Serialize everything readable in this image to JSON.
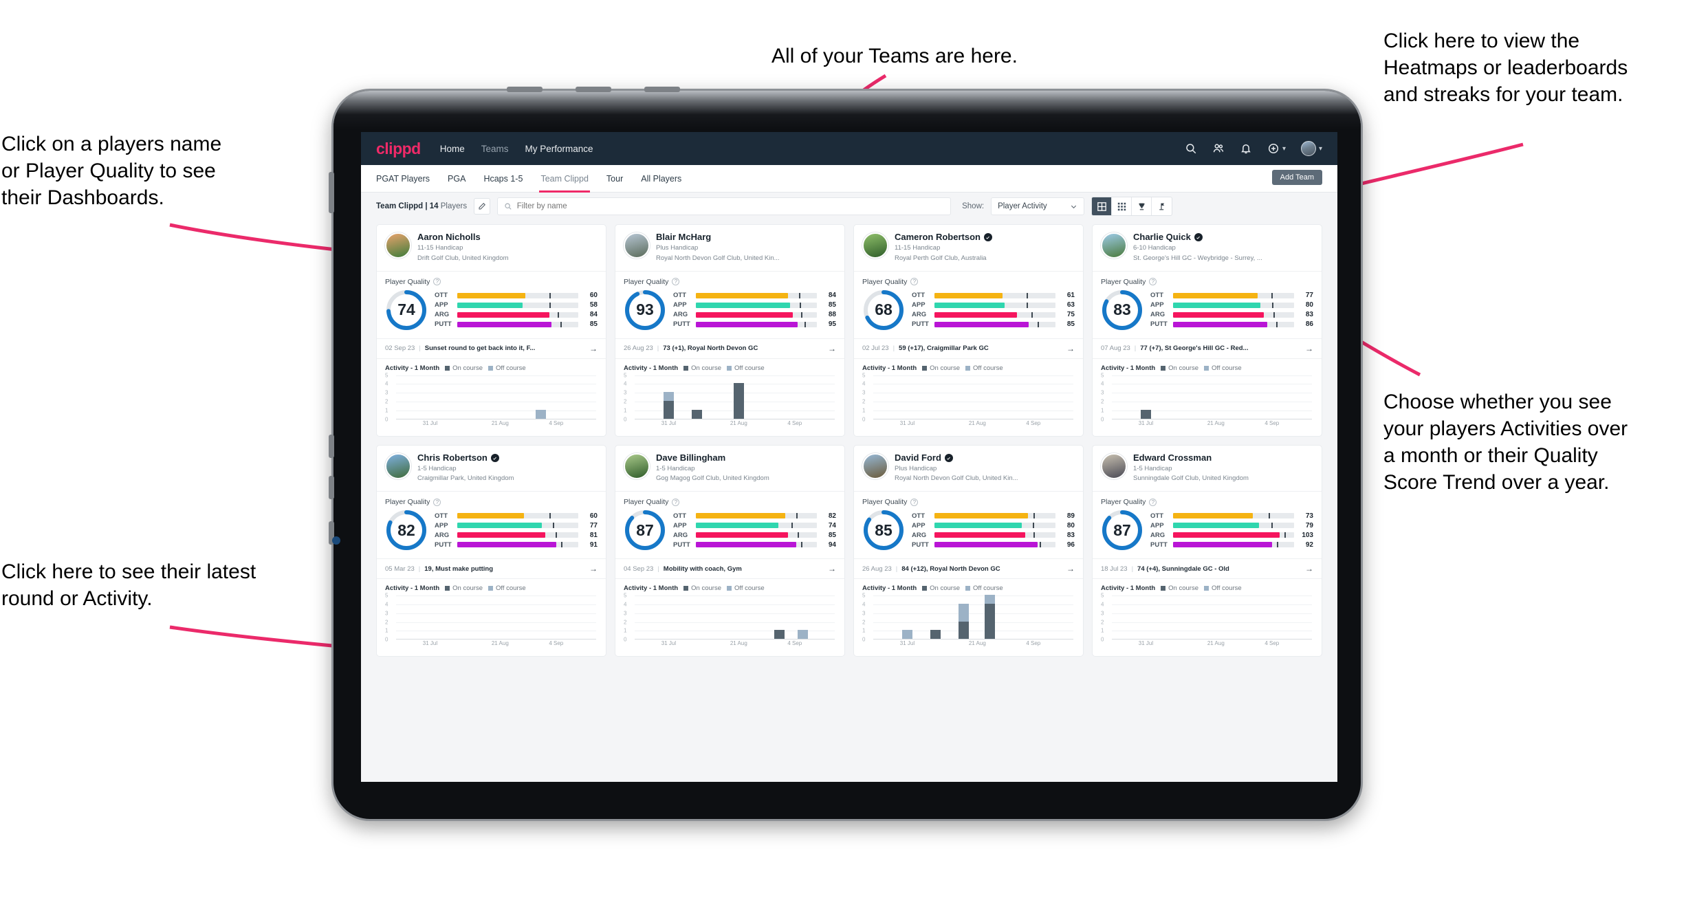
{
  "annotations": {
    "top_left": "Click on a players name\nor Player Quality to see\ntheir Dashboards.",
    "top_center": "All of your Teams are here.",
    "top_right": "Click here to view the\nHeatmaps or leaderboards\nand streaks for your team.",
    "right_middle": "Choose whether you see\nyour players Activities over\na month or their Quality\nScore Trend over a year.",
    "bottom_left": "Click here to see their latest\nround or Activity."
  },
  "navbar": {
    "logo": "clippd",
    "links": [
      {
        "label": "Home",
        "dim": false
      },
      {
        "label": "Teams",
        "dim": true
      },
      {
        "label": "My Performance",
        "dim": false
      }
    ],
    "icons": [
      "search-icon",
      "people-icon",
      "bell-icon",
      "plus-circle-icon",
      "avatar"
    ]
  },
  "tabs": [
    {
      "label": "PGAT Players",
      "active": false
    },
    {
      "label": "PGA",
      "active": false
    },
    {
      "label": "Hcaps 1-5",
      "active": false
    },
    {
      "label": "Team Clippd",
      "active": true
    },
    {
      "label": "Tour",
      "active": false
    },
    {
      "label": "All Players",
      "active": false
    }
  ],
  "add_team_label": "Add Team",
  "toolbar": {
    "team_name": "Team Clippd | 14",
    "team_suffix": " Players",
    "edit_icon": "pencil-icon",
    "search_placeholder": "Filter by name",
    "search_value": "",
    "show_label": "Show:",
    "show_value": "Player Activity",
    "views": [
      {
        "name": "grid-view-icon",
        "active": true
      },
      {
        "name": "dense-grid-view-icon",
        "active": false
      },
      {
        "name": "trophy-view-icon",
        "active": false
      },
      {
        "name": "flag-view-icon",
        "active": false
      }
    ]
  },
  "card_labels": {
    "player_quality": "Player Quality",
    "activity_title": "Activity - 1 Month",
    "legend_on": "On course",
    "legend_off": "Off course"
  },
  "metric_colors": {
    "OTT": "#f5b312",
    "APP": "#2fd6ae",
    "ARG": "#f5155e",
    "PUTT": "#b915d6",
    "ring": "#1678c8",
    "ring_track": "#dfe3e7",
    "on_course": "#55646f",
    "off_course": "#9cb2c6",
    "brand": "#ef2a68",
    "annotation_arrow": "#eb2a6a"
  },
  "chart_data": {
    "type": "bar",
    "title": "Activity - 1 Month",
    "stacked": true,
    "ylim": [
      0,
      5
    ],
    "yticks": [
      0,
      1,
      2,
      3,
      4,
      5
    ],
    "xlabel": "",
    "ylabel": "",
    "xticks": [
      "31 Jul",
      "21 Aug",
      "4 Sep"
    ],
    "legend": [
      "On course",
      "Off course"
    ],
    "legend_position": "top",
    "grid": true
  },
  "players": [
    {
      "name": "Aaron Nicholls",
      "verified": false,
      "handicap": "11-15 Handicap",
      "club": "Drift Golf Club, United Kingdom",
      "quality": 74,
      "metrics": [
        {
          "key": "OTT",
          "value": 60,
          "fill": 56,
          "tick": 76
        },
        {
          "key": "APP",
          "value": 58,
          "fill": 54,
          "tick": 76
        },
        {
          "key": "ARG",
          "value": 84,
          "fill": 76,
          "tick": 83
        },
        {
          "key": "PUTT",
          "value": 85,
          "fill": 78,
          "tick": 85
        }
      ],
      "last_date": "02 Sep 23",
      "last_text": "Sunset round to get back into it, F...",
      "avatar_from": "#e8a36d",
      "avatar_to": "#3e7c3a",
      "activity": [
        {
          "x": 0.72,
          "on": 0,
          "off": 1
        }
      ]
    },
    {
      "name": "Blair McHarg",
      "verified": false,
      "handicap": "Plus Handicap",
      "club": "Royal North Devon Golf Club, United Kin...",
      "quality": 93,
      "metrics": [
        {
          "key": "OTT",
          "value": 84,
          "fill": 76,
          "tick": 85
        },
        {
          "key": "APP",
          "value": 85,
          "fill": 78,
          "tick": 86
        },
        {
          "key": "ARG",
          "value": 88,
          "fill": 80,
          "tick": 87
        },
        {
          "key": "PUTT",
          "value": 95,
          "fill": 84,
          "tick": 90
        }
      ],
      "last_date": "26 Aug 23",
      "last_text": "73 (+1), Royal North Devon GC",
      "avatar_from": "#b7c6d4",
      "avatar_to": "#5a6b5a",
      "activity": [
        {
          "x": 0.17,
          "on": 2,
          "off": 1
        },
        {
          "x": 0.31,
          "on": 1,
          "off": 0
        },
        {
          "x": 0.52,
          "on": 4,
          "off": 0
        }
      ]
    },
    {
      "name": "Cameron Robertson",
      "verified": true,
      "handicap": "11-15 Handicap",
      "club": "Royal Perth Golf Club, Australia",
      "quality": 68,
      "metrics": [
        {
          "key": "OTT",
          "value": 61,
          "fill": 56,
          "tick": 76
        },
        {
          "key": "APP",
          "value": 63,
          "fill": 58,
          "tick": 76
        },
        {
          "key": "ARG",
          "value": 75,
          "fill": 68,
          "tick": 80
        },
        {
          "key": "PUTT",
          "value": 85,
          "fill": 78,
          "tick": 85
        }
      ],
      "last_date": "02 Jul 23",
      "last_text": "59 (+17), Craigmillar Park GC",
      "avatar_from": "#8fbf6a",
      "avatar_to": "#2f5e2a",
      "activity": []
    },
    {
      "name": "Charlie Quick",
      "verified": true,
      "handicap": "6-10 Handicap",
      "club": "St. George's Hill GC - Weybridge - Surrey, ...",
      "quality": 83,
      "metrics": [
        {
          "key": "OTT",
          "value": 77,
          "fill": 70,
          "tick": 81
        },
        {
          "key": "APP",
          "value": 80,
          "fill": 72,
          "tick": 82
        },
        {
          "key": "ARG",
          "value": 83,
          "fill": 75,
          "tick": 83
        },
        {
          "key": "PUTT",
          "value": 86,
          "fill": 78,
          "tick": 85
        }
      ],
      "last_date": "07 Aug 23",
      "last_text": "77 (+7), St George's Hill GC - Red...",
      "avatar_from": "#9ecbe8",
      "avatar_to": "#4a7a3c",
      "activity": [
        {
          "x": 0.17,
          "on": 1,
          "off": 0
        }
      ]
    },
    {
      "name": "Chris Robertson",
      "verified": true,
      "handicap": "1-5 Handicap",
      "club": "Craigmillar Park, United Kingdom",
      "quality": 82,
      "metrics": [
        {
          "key": "OTT",
          "value": 60,
          "fill": 55,
          "tick": 76
        },
        {
          "key": "APP",
          "value": 77,
          "fill": 70,
          "tick": 79
        },
        {
          "key": "ARG",
          "value": 81,
          "fill": 73,
          "tick": 81
        },
        {
          "key": "PUTT",
          "value": 91,
          "fill": 82,
          "tick": 86
        }
      ],
      "last_date": "05 Mar 23",
      "last_text": "19, Must make putting",
      "avatar_from": "#7fb0e0",
      "avatar_to": "#3f6b3a",
      "activity": []
    },
    {
      "name": "Dave Billingham",
      "verified": false,
      "handicap": "1-5 Handicap",
      "club": "Gog Magog Golf Club, United Kingdom",
      "quality": 87,
      "metrics": [
        {
          "key": "OTT",
          "value": 82,
          "fill": 74,
          "tick": 83
        },
        {
          "key": "APP",
          "value": 74,
          "fill": 68,
          "tick": 79
        },
        {
          "key": "ARG",
          "value": 85,
          "fill": 76,
          "tick": 84
        },
        {
          "key": "PUTT",
          "value": 94,
          "fill": 83,
          "tick": 87
        }
      ],
      "last_date": "04 Sep 23",
      "last_text": "Mobility with coach, Gym",
      "avatar_from": "#a9c98a",
      "avatar_to": "#2f5c2a",
      "activity": [
        {
          "x": 0.72,
          "on": 1,
          "off": 0
        },
        {
          "x": 0.84,
          "on": 0,
          "off": 1
        }
      ]
    },
    {
      "name": "David Ford",
      "verified": true,
      "handicap": "Plus Handicap",
      "club": "Royal North Devon Golf Club, United Kin...",
      "quality": 85,
      "metrics": [
        {
          "key": "OTT",
          "value": 89,
          "fill": 77,
          "tick": 82
        },
        {
          "key": "APP",
          "value": 80,
          "fill": 72,
          "tick": 81
        },
        {
          "key": "ARG",
          "value": 83,
          "fill": 75,
          "tick": 82
        },
        {
          "key": "PUTT",
          "value": 96,
          "fill": 85,
          "tick": 87
        }
      ],
      "last_date": "26 Aug 23",
      "last_text": "84 (+12), Royal North Devon GC",
      "avatar_from": "#96b8d6",
      "avatar_to": "#6b5b3a",
      "activity": [
        {
          "x": 0.17,
          "on": 0,
          "off": 1
        },
        {
          "x": 0.31,
          "on": 1,
          "off": 0
        },
        {
          "x": 0.45,
          "on": 2,
          "off": 2
        },
        {
          "x": 0.58,
          "on": 4,
          "off": 1
        }
      ]
    },
    {
      "name": "Edward Crossman",
      "verified": false,
      "handicap": "1-5 Handicap",
      "club": "Sunningdale Golf Club, United Kingdom",
      "quality": 87,
      "metrics": [
        {
          "key": "OTT",
          "value": 73,
          "fill": 66,
          "tick": 79
        },
        {
          "key": "APP",
          "value": 79,
          "fill": 71,
          "tick": 81
        },
        {
          "key": "ARG",
          "value": 103,
          "fill": 88,
          "tick": 92
        },
        {
          "key": "PUTT",
          "value": 92,
          "fill": 82,
          "tick": 86
        }
      ],
      "last_date": "18 Jul 23",
      "last_text": "74 (+4), Sunningdale GC - Old",
      "avatar_from": "#c8c0b0",
      "avatar_to": "#4a4a55",
      "activity": []
    }
  ]
}
